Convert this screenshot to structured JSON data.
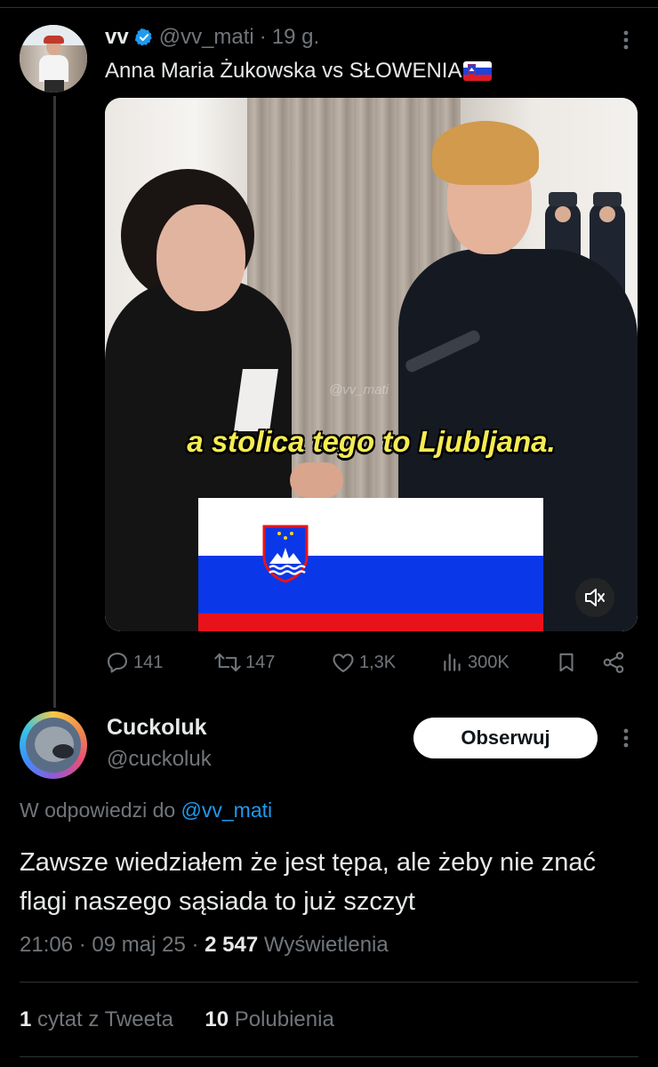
{
  "parent_tweet": {
    "display_name": "vv",
    "handle": "@vv_mati",
    "separator": "·",
    "time": "19 g.",
    "text": "Anna Maria Żukowska vs SŁOWENIA",
    "media": {
      "caption": "a stolica tego to Ljubljana.",
      "watermark": "@vv_mati"
    },
    "actions": {
      "replies": "141",
      "retweets": "147",
      "likes": "1,3K",
      "views": "300K"
    }
  },
  "reply": {
    "display_name": "Cuckoluk",
    "handle": "@cuckoluk",
    "follow_label": "Obserwuj",
    "in_reply_prefix": "W odpowiedzi do",
    "in_reply_mention": "@vv_mati",
    "text": "Zawsze wiedziałem że jest tępa, ale żeby nie znać flagi naszego sąsiada to już szczyt",
    "time": "21:06",
    "date": "09 maj 25",
    "views_count": "2 547",
    "views_label": "Wyświetlenia",
    "quotes_count": "1",
    "quotes_label": "cytat z Tweeta",
    "likes_count": "10",
    "likes_label": "Polubienia"
  },
  "colors": {
    "background": "#000000",
    "text": "#e7e9ea",
    "muted": "#71767b",
    "accent": "#1d9bf0",
    "caption_yellow": "#f5ec52"
  },
  "icons": [
    "verified-badge-icon",
    "more-icon",
    "reply-icon",
    "retweet-icon",
    "like-icon",
    "views-icon",
    "bookmark-icon",
    "share-icon",
    "mute-icon"
  ]
}
